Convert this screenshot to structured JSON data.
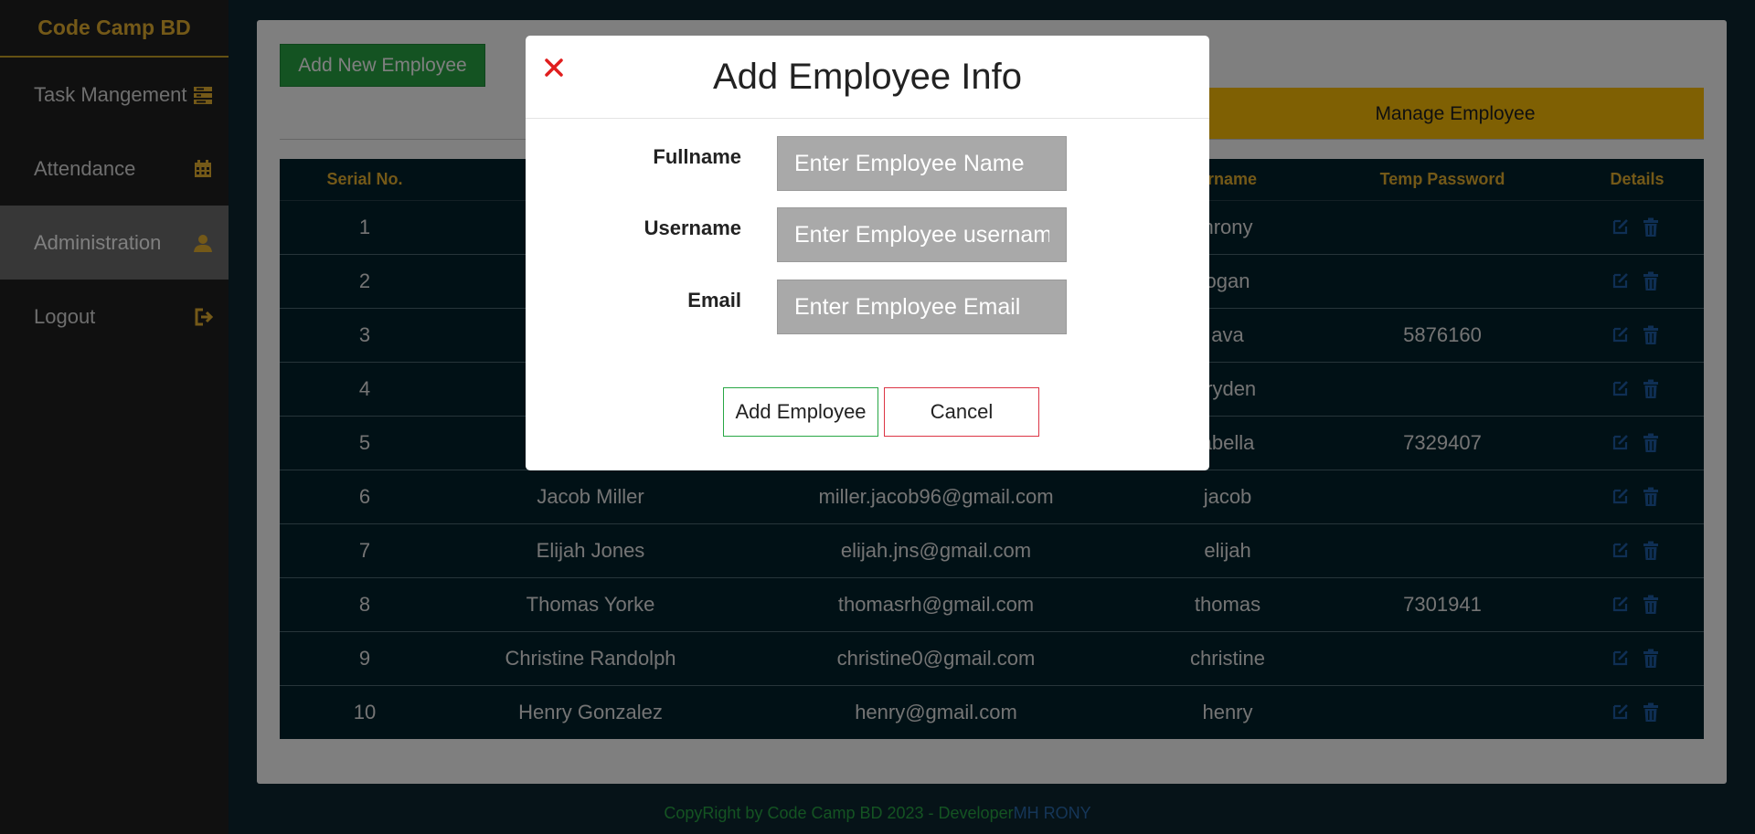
{
  "app": {
    "brand": "Code Camp BD"
  },
  "sidebar": {
    "items": [
      {
        "label": "Task Mangement",
        "icon": "tasks-icon",
        "active": false
      },
      {
        "label": "Attendance",
        "icon": "calendar-icon",
        "active": false
      },
      {
        "label": "Administration",
        "icon": "user-icon",
        "active": true
      },
      {
        "label": "Logout",
        "icon": "logout-icon",
        "active": false
      }
    ]
  },
  "main": {
    "add_new_label": "Add New Employee",
    "manage_tab_label": "Manage Employee",
    "table": {
      "headers": [
        "Serial No.",
        "",
        "",
        "ername",
        "Temp Password",
        "Details"
      ],
      "rows": [
        {
          "serial": "1",
          "name": "",
          "email": "",
          "username": "hrony",
          "temp_password": ""
        },
        {
          "serial": "2",
          "name": "",
          "email": "",
          "username": "ogan",
          "temp_password": ""
        },
        {
          "serial": "3",
          "name": "",
          "email": "",
          "username": "ava",
          "temp_password": "5876160"
        },
        {
          "serial": "4",
          "name": "",
          "email": "",
          "username": "rryden",
          "temp_password": ""
        },
        {
          "serial": "5",
          "name": "",
          "email": "",
          "username": "abella",
          "temp_password": "7329407"
        },
        {
          "serial": "6",
          "name": "Jacob Miller",
          "email": "miller.jacob96@gmail.com",
          "username": "jacob",
          "temp_password": ""
        },
        {
          "serial": "7",
          "name": "Elijah Jones",
          "email": "elijah.jns@gmail.com",
          "username": "elijah",
          "temp_password": ""
        },
        {
          "serial": "8",
          "name": "Thomas Yorke",
          "email": "thomasrh@gmail.com",
          "username": "thomas",
          "temp_password": "7301941"
        },
        {
          "serial": "9",
          "name": "Christine Randolph",
          "email": "christine0@gmail.com",
          "username": "christine",
          "temp_password": ""
        },
        {
          "serial": "10",
          "name": "Henry Gonzalez",
          "email": "henry@gmail.com",
          "username": "henry",
          "temp_password": ""
        }
      ]
    }
  },
  "footer": {
    "text": "CopyRight by Code Camp BD 2023 - Developer",
    "developer": "MH RONY"
  },
  "modal": {
    "title": "Add Employee Info",
    "fields": [
      {
        "label": "Fullname",
        "placeholder": "Enter Employee Name",
        "value": ""
      },
      {
        "label": "Username",
        "placeholder": "Enter Employee username",
        "value": ""
      },
      {
        "label": "Email",
        "placeholder": "Enter Employee Email",
        "value": ""
      }
    ],
    "submit_label": "Add Employee",
    "cancel_label": "Cancel"
  },
  "colors": {
    "brand": "#e8b230",
    "sidebar_bg": "#212121",
    "page_bg": "#0c2630",
    "table_bg": "#03222c",
    "add_green": "#28a745",
    "manage_yellow": "#ffc107",
    "close_red": "#e01e1e",
    "edit_icon": "#1e5fa8"
  }
}
